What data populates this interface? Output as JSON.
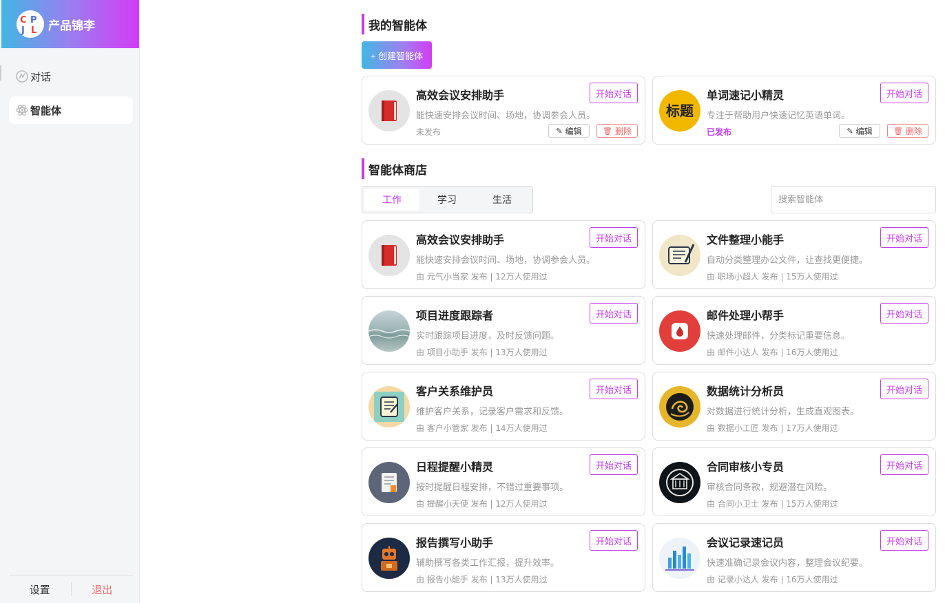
{
  "brand": {
    "logo_text": "CPJL",
    "name": "产品锦李"
  },
  "nav": {
    "chat": "对话",
    "agents": "智能体"
  },
  "footer": {
    "settings": "设置",
    "logout": "退出"
  },
  "my_agents": {
    "title": "我的智能体",
    "create_label": "+ 创建智能体",
    "start_label": "开始对话",
    "edit_label": "编辑",
    "delete_label": "删除",
    "cards": [
      {
        "title": "高效会议安排助手",
        "desc": "能快速安排会议时间、场地，协调参会人员。",
        "status": "未发布",
        "icon": "red-book-icon"
      },
      {
        "title": "单词速记小精灵",
        "desc": "专注于帮助用户快速记忆英语单词。",
        "status": "已发布",
        "icon": "title-badge-icon",
        "badge_text": "标题"
      }
    ]
  },
  "store": {
    "title": "智能体商店",
    "tabs": [
      "工作",
      "学习",
      "生活"
    ],
    "active_tab": "工作",
    "search_placeholder": "搜索智能体",
    "start_label": "开始对话",
    "cards": [
      {
        "title": "高效会议安排助手",
        "desc": "能快速安排会议时间、场地，协调参会人员。",
        "meta": "由 元气小当家 发布 | 12万人使用过",
        "icon": "red-book-icon"
      },
      {
        "title": "文件整理小能手",
        "desc": "自动分类整理办公文件，让查找更便捷。",
        "meta": "由 职场小超人 发布 | 15万人使用过",
        "icon": "quill-scroll-icon"
      },
      {
        "title": "项目进度跟踪者",
        "desc": "实时跟踪项目进度，及时反馈问题。",
        "meta": "由 项目小助手 发布 | 13万人使用过",
        "icon": "sea-photo-icon"
      },
      {
        "title": "邮件处理小帮手",
        "desc": "快速处理邮件，分类标记重要信息。",
        "meta": "由 邮件小达人 发布 | 16万人使用过",
        "icon": "mail-drop-icon"
      },
      {
        "title": "客户关系维护员",
        "desc": "维护客户关系，记录客户需求和反馈。",
        "meta": "由 客户小管家 发布 | 14万人使用过",
        "icon": "notepad-icon"
      },
      {
        "title": "数据统计分析员",
        "desc": "对数据进行统计分析，生成直观图表。",
        "meta": "由 数据小工匠 发布 | 17万人使用过",
        "icon": "swirl-emblem-icon"
      },
      {
        "title": "日程提醒小精灵",
        "desc": "按时提醒日程安排，不错过重要事项。",
        "meta": "由 提醒小天使 发布 | 12万人使用过",
        "icon": "document-icon"
      },
      {
        "title": "合同审核小专员",
        "desc": "审核合同条款，规避潜在风险。",
        "meta": "由 合同小卫士 发布 | 15万人使用过",
        "icon": "building-emblem-icon"
      },
      {
        "title": "报告撰写小助手",
        "desc": "辅助撰写各类工作汇报，提升效率。",
        "meta": "由 报告小能手 发布 | 13万人使用过",
        "icon": "robot-icon"
      },
      {
        "title": "会议记录速记员",
        "desc": "快速准确记录会议内容，整理会议纪要。",
        "meta": "由 记录小达人 发布 | 16万人使用过",
        "icon": "chart-city-icon"
      }
    ]
  },
  "colors": {
    "accent": "#c53cf0",
    "gradient_start": "#43b6e4",
    "gradient_end": "#d43bf6",
    "danger": "#e66666"
  }
}
